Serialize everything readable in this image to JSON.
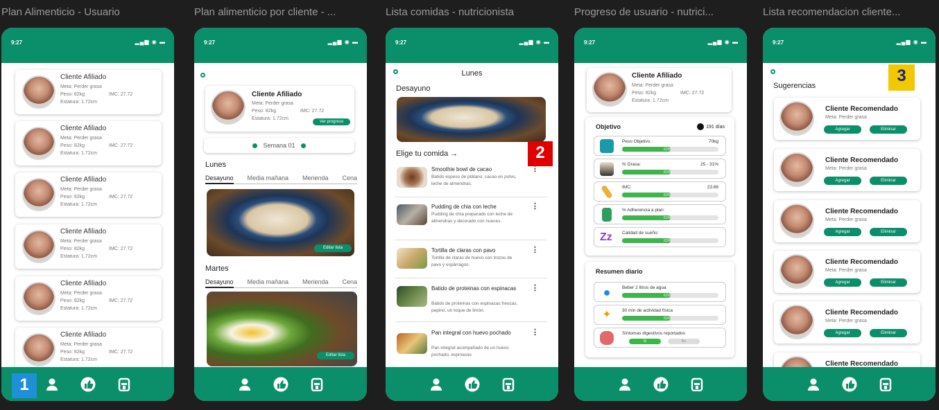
{
  "screens": [
    {
      "title": "Plan Alimenticio - Usuario"
    },
    {
      "title": "Plan alimenticio por cliente - ..."
    },
    {
      "title": "Lista  comidas - nutricionista"
    },
    {
      "title": "Progreso de usuario - nutrici..."
    },
    {
      "title": "Lista recomendacion cliente..."
    }
  ],
  "status": {
    "time": "9:27",
    "icons": "signal-wifi-battery"
  },
  "client": {
    "name": "Cliente Afiliado",
    "meta": "Meta: Perder grasa",
    "peso": "Peso: 82kg",
    "imc": "IMC: 27.72",
    "estatura": "Estatura: 1.72cm"
  },
  "screen2": {
    "ver_progreso": "Ver progreso",
    "week": "Semana 01",
    "day1": "Lunes",
    "day2": "Martes",
    "tabs": [
      "Desayuno",
      "Media mañana",
      "Merienda",
      "Cena"
    ],
    "edit_label": "Editar lista"
  },
  "screen3": {
    "day": "Lunes",
    "section": "Desayuno",
    "choose": "Elige tu comida",
    "foods": [
      {
        "name": "Smoothie bowl de cacao",
        "desc": "Batido espeso de plátano, cacao en polvo, leche de almendras."
      },
      {
        "name": "Pudding de chia con leche",
        "desc": "Pudding de chía preparado con leche de almendras y decorado con nueces."
      },
      {
        "name": "Tortilla de claras con pavo",
        "desc": "Tortilla de claras de huevo con trozos de pavo y espárragos."
      },
      {
        "name": "Batido de proteinas con espinacas",
        "desc": "Batido de proteínas con espinacas frescas, pepino, un toque de limón."
      },
      {
        "name": "Pan integral con huevo pochado",
        "desc": "Pan integral acompañado de un huevo pochado, espinacas"
      }
    ]
  },
  "screen4": {
    "objetivo": "Objetivo",
    "days": "191 días",
    "metrics": [
      {
        "label": "Peso Objetivo :",
        "value": "70kg",
        "pct": "61%",
        "fill": 0.5
      },
      {
        "label": "% Grasa:",
        "value": "25 - 31%",
        "pct": "61%",
        "fill": 0.5
      },
      {
        "label": "IMC:",
        "value": "23.66",
        "pct": "61%",
        "fill": 0.5
      },
      {
        "label": "% Adherencia a plan:",
        "value": "",
        "pct": "61%",
        "fill": 0.5
      },
      {
        "label": "Calidad de sueño:",
        "value": "",
        "pct": "61%",
        "fill": 0.5
      }
    ],
    "resumen": "Resumen diario",
    "daily": [
      {
        "label": "Beber 2 litros de agua",
        "pct": "61%",
        "fill": 0.5
      },
      {
        "label": "30 min de actividad física",
        "pct": "61%",
        "fill": 0.5
      },
      {
        "label": "Síntomas digestivos reportados",
        "yes": "Sí",
        "no": "No"
      }
    ]
  },
  "screen5": {
    "title": "Sugerencias",
    "name": "Cliente Recomendado",
    "meta": "Meta: Perder grasa",
    "agregar": "Agregar",
    "eliminar": "Eliminar"
  },
  "badges": [
    "1",
    "2",
    "3"
  ],
  "colors": {
    "brand": "#0a8f6a",
    "progress": "#3cb54a",
    "badge_blue": "#1f8fd6",
    "badge_red": "#e00000",
    "badge_yellow": "#f2c800"
  }
}
